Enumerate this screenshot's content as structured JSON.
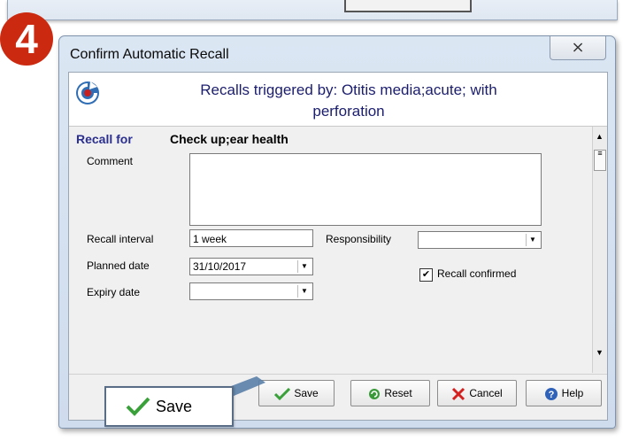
{
  "step_number": "4",
  "dialog": {
    "title": "Confirm Automatic Recall",
    "close_glyph": "⨯",
    "header": {
      "line1": "Recalls triggered by: Otitis media;acute; with",
      "line2": "perforation"
    }
  },
  "form": {
    "recall_for_label": "Recall for",
    "recall_for_value": "Check up;ear health",
    "comment_label": "Comment",
    "comment_value": "",
    "recall_interval_label": "Recall interval",
    "recall_interval_value": "1 week",
    "responsibility_label": "Responsibility",
    "responsibility_value": "",
    "planned_date_label": "Planned date",
    "planned_date_value": "31/10/2017",
    "recall_confirmed_label": "Recall confirmed",
    "recall_confirmed_checked": true,
    "expiry_date_label": "Expiry date",
    "expiry_date_value": ""
  },
  "buttons": {
    "save": "Save",
    "reset": "Reset",
    "cancel": "Cancel",
    "help": "Help"
  },
  "callout": {
    "label": "Save"
  },
  "colors": {
    "badge": "#cc2a10",
    "header_text": "#1b1d6e",
    "recall_for": "#2b2f8f"
  }
}
